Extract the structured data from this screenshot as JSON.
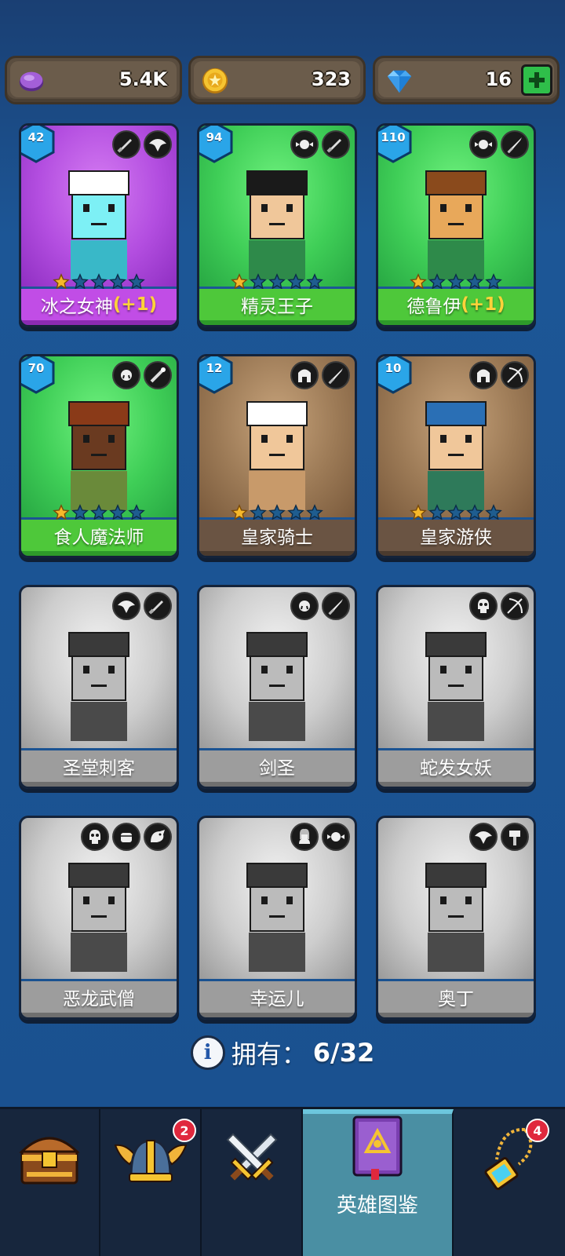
{
  "currencies": [
    {
      "icon": "purple-gem-icon",
      "value": "5.4K"
    },
    {
      "icon": "gold-coin-icon",
      "value": "323"
    },
    {
      "icon": "blue-diamond-icon",
      "value": "16"
    }
  ],
  "heroes": [
    {
      "name": "冰之女神",
      "bonus": "(+1)",
      "level": "42",
      "stars": 1,
      "theme": "purple",
      "badges": [
        "dagger-icon",
        "winged-crest-icon"
      ],
      "owned": true
    },
    {
      "name": "精灵王子",
      "bonus": "",
      "level": "94",
      "stars": 1,
      "theme": "green",
      "badges": [
        "elf-icon",
        "dagger-icon"
      ],
      "owned": true
    },
    {
      "name": "德鲁伊",
      "bonus": "(+1)",
      "level": "110",
      "stars": 1,
      "theme": "green",
      "badges": [
        "elf-icon",
        "sword-icon"
      ],
      "owned": true
    },
    {
      "name": "食人魔法师",
      "bonus": "",
      "level": "70",
      "stars": 1,
      "theme": "green",
      "badges": [
        "orc-icon",
        "wand-icon"
      ],
      "owned": true
    },
    {
      "name": "皇家骑士",
      "bonus": "",
      "level": "12",
      "stars": 1,
      "theme": "brown",
      "badges": [
        "helmet-icon",
        "sword-icon"
      ],
      "owned": true
    },
    {
      "name": "皇家游侠",
      "bonus": "",
      "level": "10",
      "stars": 1,
      "theme": "brown",
      "badges": [
        "helmet-icon",
        "bow-icon"
      ],
      "owned": true
    },
    {
      "name": "圣堂刺客",
      "bonus": "",
      "level": "",
      "stars": 0,
      "theme": "gray",
      "badges": [
        "winged-crest-icon",
        "dagger-icon"
      ],
      "owned": false
    },
    {
      "name": "剑圣",
      "bonus": "",
      "level": "",
      "stars": 0,
      "theme": "gray",
      "badges": [
        "orc-icon",
        "sword-icon"
      ],
      "owned": false
    },
    {
      "name": "蛇发女妖",
      "bonus": "",
      "level": "",
      "stars": 0,
      "theme": "gray",
      "badges": [
        "skull-icon",
        "bow-icon"
      ],
      "owned": false
    },
    {
      "name": "恶龙武僧",
      "bonus": "",
      "level": "",
      "stars": 0,
      "theme": "gray",
      "badges": [
        "skull-icon",
        "fist-icon",
        "dragon-icon"
      ],
      "owned": false
    },
    {
      "name": "幸运儿",
      "bonus": "",
      "level": "",
      "stars": 0,
      "theme": "gray",
      "badges": [
        "woman-icon",
        "elf-icon"
      ],
      "owned": false
    },
    {
      "name": "奥丁",
      "bonus": "",
      "level": "",
      "stars": 0,
      "theme": "gray",
      "badges": [
        "winged-crest-icon",
        "hammer-icon"
      ],
      "owned": false
    }
  ],
  "owned_summary": {
    "label": "拥有：",
    "count": "6/32"
  },
  "nav": [
    {
      "icon": "treasure-chest-icon",
      "label": "",
      "badge": "",
      "active": false
    },
    {
      "icon": "viking-helmet-icon",
      "label": "",
      "badge": "2",
      "active": false
    },
    {
      "icon": "crossed-swords-icon",
      "label": "",
      "badge": "",
      "active": false
    },
    {
      "icon": "hero-book-icon",
      "label": "英雄图鉴",
      "badge": "",
      "active": true
    },
    {
      "icon": "amulet-icon",
      "label": "",
      "badge": "4",
      "active": false
    }
  ],
  "colors": {
    "background": "#1c5696",
    "card_purple": "#c14de6",
    "card_green": "#4ec83a",
    "card_brown": "#6a5443",
    "card_gray": "#9d9d9d",
    "star_gold": "#f6b82a",
    "nav_active": "#4a8fa3",
    "notification": "#e0283d"
  }
}
